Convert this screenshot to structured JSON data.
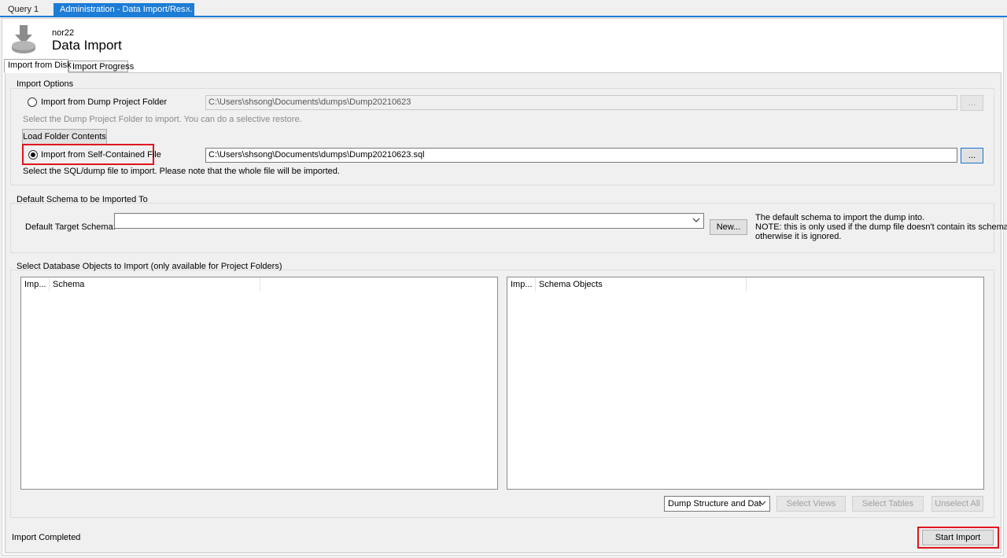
{
  "tabs": {
    "query_tab": "Query 1",
    "active_tab": "Administration - Data Import/Res...",
    "close_glyph": "×"
  },
  "header": {
    "connection": "nor22",
    "title": "Data Import",
    "icon": "import-disk-icon"
  },
  "subtabs": {
    "import_from_disk": "Import from Disk",
    "import_progress": "Import Progress"
  },
  "import_options": {
    "title": "Import Options",
    "dump_folder_label": "Import from Dump Project Folder",
    "dump_folder_path": "C:\\Users\\shsong\\Documents\\dumps\\Dump20210623",
    "browse_label": "...",
    "folder_hint": "Select the Dump Project Folder to import. You can do a selective restore.",
    "load_folder_label": "Load Folder Contents",
    "self_contained_label": "Import from Self-Contained File",
    "self_contained_path": "C:\\Users\\shsong\\Documents\\dumps\\Dump20210623.sql",
    "file_hint": "Select the SQL/dump file to import. Please note that the whole file will be imported.",
    "selected_option": "self_contained"
  },
  "default_schema": {
    "title": "Default Schema to be Imported To",
    "target_label": "Default Target Schema:",
    "target_value": "",
    "new_label": "New...",
    "note_line1": "The default schema to import the dump into.",
    "note_line2": "NOTE: this is only used if the dump file doesn't contain its schema,",
    "note_line3": "otherwise it is ignored."
  },
  "objects": {
    "title": "Select Database Objects to Import (only available for Project Folders)",
    "left_col1": "Imp...",
    "left_col2": "Schema",
    "right_col1": "Imp...",
    "right_col2": "Schema Objects",
    "dump_mode": "Dump Structure and Dat",
    "select_views": "Select Views",
    "select_tables": "Select Tables",
    "unselect_all": "Unselect All"
  },
  "footer": {
    "status": "Import Completed",
    "start_import": "Start Import"
  },
  "colors": {
    "accent": "#1c7cd6",
    "highlight": "#e0141e"
  }
}
